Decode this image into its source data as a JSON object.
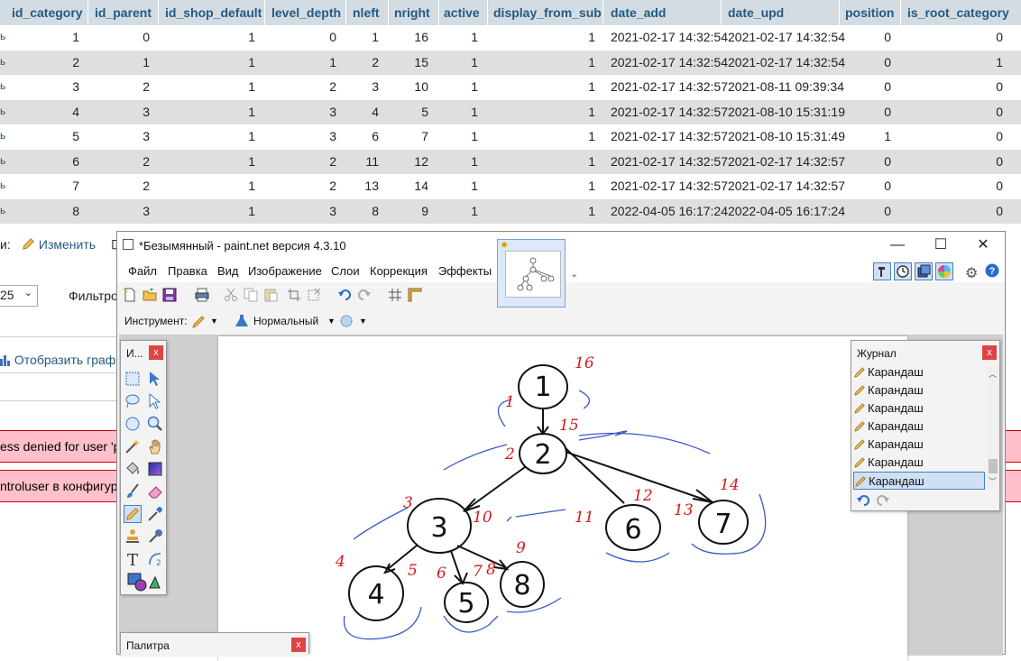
{
  "table": {
    "columns": [
      "id_category",
      "id_parent",
      "id_shop_default",
      "level_depth",
      "nleft",
      "nright",
      "active",
      "display_from_sub",
      "date_add",
      "date_upd",
      "position",
      "is_root_category"
    ],
    "row_marker": "ь",
    "rows": [
      [
        "1",
        "0",
        "1",
        "0",
        "1",
        "16",
        "1",
        "1",
        "2021-02-17 14:32:54",
        "2021-02-17 14:32:54",
        "0",
        "0"
      ],
      [
        "2",
        "1",
        "1",
        "1",
        "2",
        "15",
        "1",
        "1",
        "2021-02-17 14:32:54",
        "2021-02-17 14:32:54",
        "0",
        "1"
      ],
      [
        "3",
        "2",
        "1",
        "2",
        "3",
        "10",
        "1",
        "1",
        "2021-02-17 14:32:57",
        "2021-08-11 09:39:34",
        "0",
        "0"
      ],
      [
        "4",
        "3",
        "1",
        "3",
        "4",
        "5",
        "1",
        "1",
        "2021-02-17 14:32:57",
        "2021-08-10 15:31:19",
        "0",
        "0"
      ],
      [
        "5",
        "3",
        "1",
        "3",
        "6",
        "7",
        "1",
        "1",
        "2021-02-17 14:32:57",
        "2021-08-10 15:31:49",
        "1",
        "0"
      ],
      [
        "6",
        "2",
        "1",
        "2",
        "11",
        "12",
        "1",
        "1",
        "2021-02-17 14:32:57",
        "2021-02-17 14:32:57",
        "0",
        "0"
      ],
      [
        "7",
        "2",
        "1",
        "2",
        "13",
        "14",
        "1",
        "1",
        "2021-02-17 14:32:57",
        "2021-02-17 14:32:57",
        "0",
        "0"
      ],
      [
        "8",
        "3",
        "1",
        "3",
        "8",
        "9",
        "1",
        "1",
        "2022-04-05 16:17:24",
        "2022-04-05 16:17:24",
        "0",
        "0"
      ]
    ]
  },
  "pma": {
    "with_selected_suffix": "и:",
    "edit_link": "Изменить",
    "rows_select": "25",
    "filter_label": "Фильтро",
    "chart_link": "Отобразить графи",
    "error1": "ess denied for user 'ph",
    "error2": "ntroluser в конфигура"
  },
  "paint": {
    "title": "*Безымянный - paint.net версия 4.3.10",
    "menu": [
      "Файл",
      "Правка",
      "Вид",
      "Изображение",
      "Слои",
      "Коррекция",
      "Эффекты"
    ],
    "tool_label": "Инструмент:",
    "blend_mode": "Нормальный",
    "tools_title": "И...",
    "history_title": "Журнал",
    "history_items": [
      "Карандаш",
      "Карандаш",
      "Карандаш",
      "Карандаш",
      "Карандаш",
      "Карандаш",
      "Карандаш"
    ],
    "palette_title": "Палитра",
    "close_glyph": "x",
    "tabs_chevron": "⌄",
    "min_glyph": "—",
    "max_glyph": "☐",
    "close_win_glyph": "✕"
  },
  "drawing": {
    "nodes": [
      "1",
      "2",
      "3",
      "4",
      "5",
      "6",
      "7",
      "8"
    ],
    "red_labels": [
      "16",
      "1",
      "15",
      "2",
      "12",
      "14",
      "3",
      "10",
      "11",
      "13",
      "4",
      "5",
      "6",
      "7",
      "8",
      "9"
    ]
  }
}
